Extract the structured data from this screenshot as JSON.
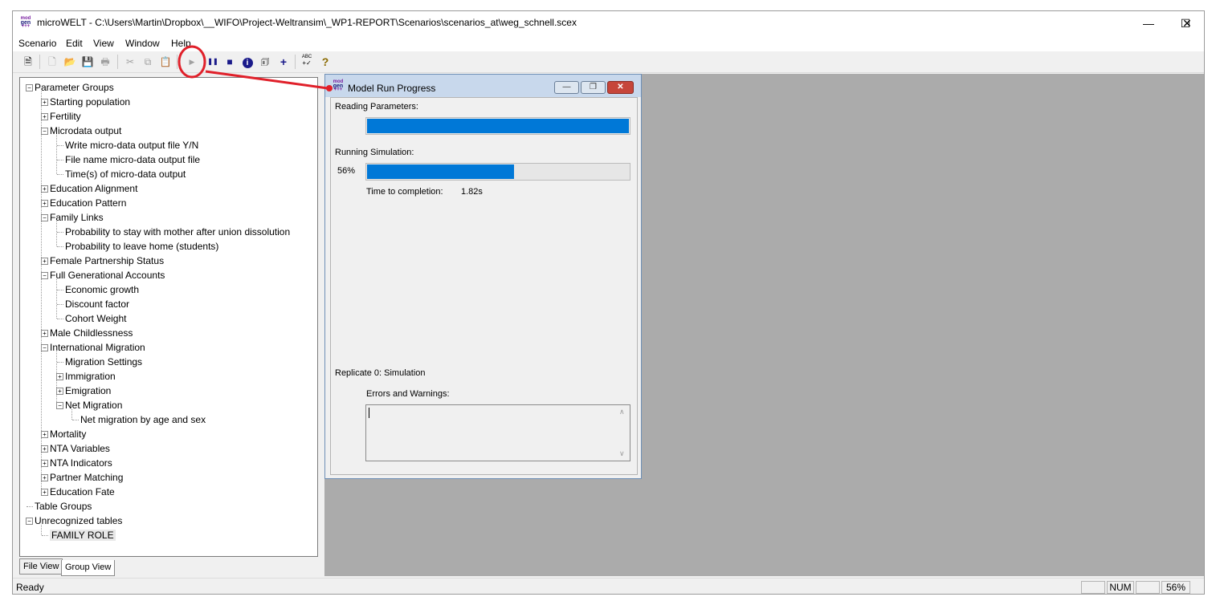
{
  "window": {
    "title": "microWELT - C:\\Users\\Martin\\Dropbox\\__WIFO\\Project-Weltransim\\_WP1-REPORT\\Scenarios\\scenarios_at\\weg_schnell.scex",
    "app_icon_top": "mod",
    "app_icon_mid": "gen",
    "app_icon_bottom": "+++",
    "minimize_glyph": "—",
    "maximize_glyph": "☐",
    "close_glyph": "✕"
  },
  "menu": [
    "Scenario",
    "Edit",
    "View",
    "Window",
    "Help"
  ],
  "toolbar": {
    "properties": "🗎",
    "new": "🗋",
    "open": "📂",
    "save": "💾",
    "print": "🖶",
    "cut": "✂",
    "copy": "⧉",
    "paste": "📋",
    "run": "▶",
    "pause": "❚❚",
    "stop": "■",
    "info": "i",
    "log": "🗊",
    "add": "+",
    "spell_top": "ABC",
    "spell_bottom": "+✓",
    "help": "?"
  },
  "tree": {
    "items": [
      {
        "label": "Parameter Groups",
        "level": 0,
        "expander": "−"
      },
      {
        "label": "Starting population",
        "level": 1,
        "expander": "+"
      },
      {
        "label": "Fertility",
        "level": 1,
        "expander": "+"
      },
      {
        "label": "Microdata output",
        "level": 1,
        "expander": "−"
      },
      {
        "label": "Write micro-data output file Y/N",
        "level": 2,
        "expander": ""
      },
      {
        "label": "File name micro-data output file",
        "level": 2,
        "expander": ""
      },
      {
        "label": "Time(s) of micro-data output",
        "level": 2,
        "expander": ""
      },
      {
        "label": "Education Alignment",
        "level": 1,
        "expander": "+"
      },
      {
        "label": "Education Pattern",
        "level": 1,
        "expander": "+"
      },
      {
        "label": "Family Links",
        "level": 1,
        "expander": "−"
      },
      {
        "label": "Probability to stay with mother after union dissolution",
        "level": 2,
        "expander": ""
      },
      {
        "label": "Probability to leave home (students)",
        "level": 2,
        "expander": ""
      },
      {
        "label": "Female Partnership Status",
        "level": 1,
        "expander": "+"
      },
      {
        "label": "Full Generational Accounts",
        "level": 1,
        "expander": "−"
      },
      {
        "label": "Economic growth",
        "level": 2,
        "expander": ""
      },
      {
        "label": "Discount factor",
        "level": 2,
        "expander": ""
      },
      {
        "label": "Cohort Weight",
        "level": 2,
        "expander": ""
      },
      {
        "label": "Male Childlessness",
        "level": 1,
        "expander": "+"
      },
      {
        "label": "International Migration",
        "level": 1,
        "expander": "−"
      },
      {
        "label": "Migration Settings",
        "level": 2,
        "expander": ""
      },
      {
        "label": "Immigration",
        "level": 2,
        "expander": "+"
      },
      {
        "label": "Emigration",
        "level": 2,
        "expander": "+"
      },
      {
        "label": "Net Migration",
        "level": 2,
        "expander": "−"
      },
      {
        "label": "Net migration by age and sex",
        "level": 3,
        "expander": ""
      },
      {
        "label": "Mortality",
        "level": 1,
        "expander": "+"
      },
      {
        "label": "NTA Variables",
        "level": 1,
        "expander": "+"
      },
      {
        "label": "NTA Indicators",
        "level": 1,
        "expander": "+"
      },
      {
        "label": "Partner Matching",
        "level": 1,
        "expander": "+"
      },
      {
        "label": "Education Fate",
        "level": 1,
        "expander": "+"
      },
      {
        "label": "Table Groups",
        "level": 0,
        "expander": ""
      },
      {
        "label": "Unrecognized tables",
        "level": 0,
        "expander": "−"
      },
      {
        "label": "FAMILY ROLE",
        "level": 1,
        "expander": "",
        "highlighted": true
      }
    ]
  },
  "tabs": [
    {
      "label": "File View",
      "active": false
    },
    {
      "label": "Group View",
      "active": true
    }
  ],
  "status": {
    "text": "Ready",
    "num": "NUM",
    "percent": "56%"
  },
  "dialog": {
    "title": "Model Run Progress",
    "icon_top": "mod",
    "icon_mid": "gen",
    "icon_bottom": "+++",
    "minimize_glyph": "—",
    "restore_glyph": "❐",
    "close_glyph": "✕",
    "reading_label": "Reading Parameters:",
    "reading_progress": 1.0,
    "running_label": "Running Simulation:",
    "running_percent": "56%",
    "running_progress": 0.56,
    "time_label": "Time to completion:",
    "time_value": "1.82s",
    "replicate_label": "Replicate 0: Simulation",
    "errors_label": "Errors and Warnings:",
    "scroll_up": "∧",
    "scroll_down": "∨"
  },
  "annotation": {
    "color": "#e0202a"
  }
}
